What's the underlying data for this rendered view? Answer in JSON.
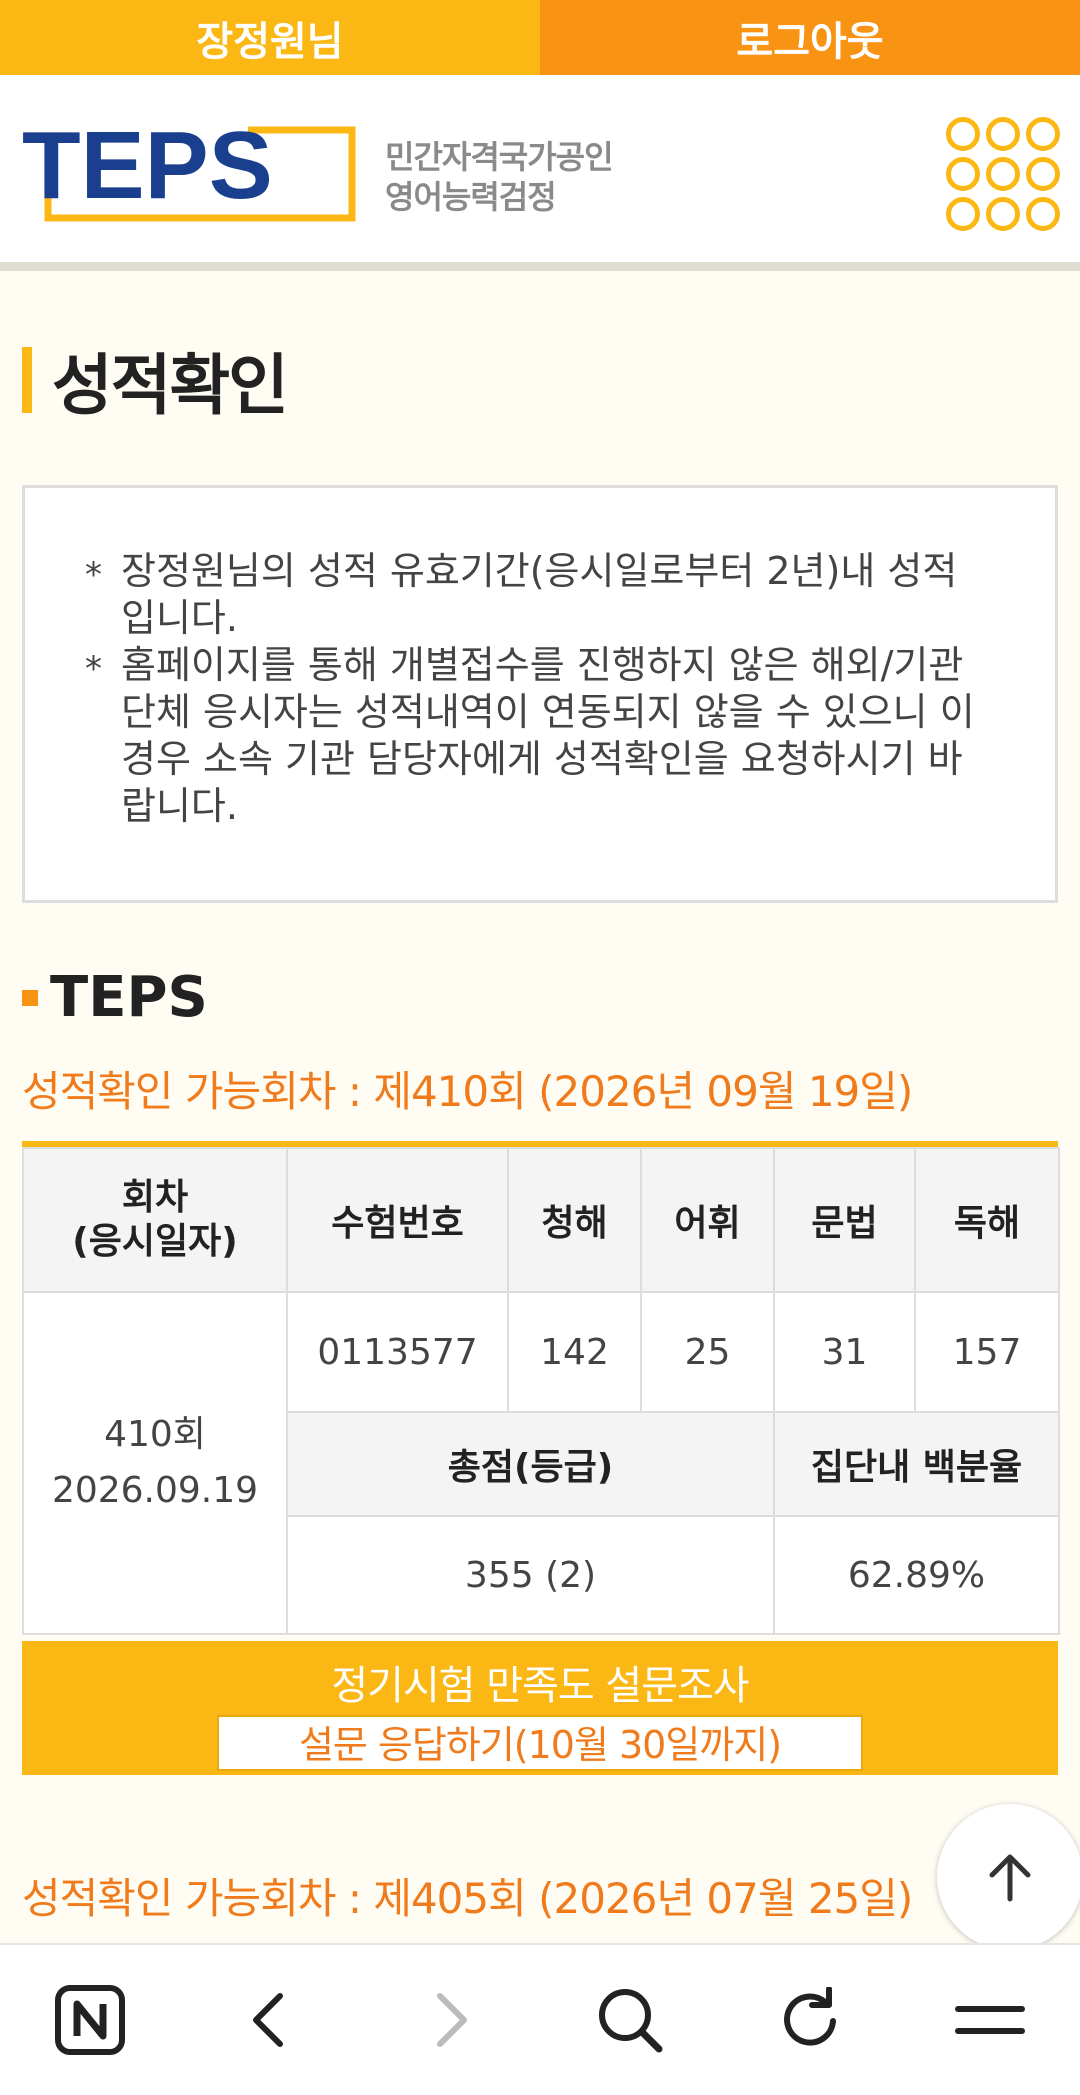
{
  "topbar": {
    "user_label": "장정원님",
    "logout_label": "로그아웃"
  },
  "header": {
    "logo_text": "TEPS",
    "subtitle_line1": "민간자격국가공인",
    "subtitle_line2": "영어능력검정",
    "menu_icon": "grid-menu-icon"
  },
  "page": {
    "title": "성적확인"
  },
  "notice": {
    "line1": "장정원님의 성적 유효기간(응시일로부터 2년)내 성적 입니다.",
    "line2": "홈페이지를 통해 개별접수를 진행하지 않은 해외/기관 단체 응시자는 성적내역이 연동되지 않을 수 있으니 이 경우 소속 기관 담당자에게 성적확인을 요청하시기 바랍니다."
  },
  "section": {
    "title": "TEPS"
  },
  "rounds": [
    {
      "available": "성적확인 가능회차 : 제410회 (2026년 09월 19일)"
    },
    {
      "available": "성적확인 가능회차 : 제405회 (2026년 07월 25일)"
    }
  ],
  "table": {
    "headers": {
      "round": "회차\n(응시일자)",
      "exam_no": "수험번호",
      "listening": "청해",
      "vocab": "어휘",
      "grammar": "문법",
      "reading": "독해"
    },
    "round_label": "410회",
    "round_date": "2026.09.19",
    "exam_no": "0113577",
    "listening": "142",
    "vocab": "25",
    "grammar": "31",
    "reading": "157",
    "total_header": "총점(등급)",
    "percentile_header": "집단내 백분율",
    "total": "355 (2)",
    "percentile": "62.89%"
  },
  "survey": {
    "title": "정기시험 만족도 설문조사",
    "button_label": "설문 응답하기(10월 30일까지)"
  },
  "colors": {
    "accent_yellow": "#fbb713",
    "accent_orange": "#f99314",
    "text_orange": "#f07b1c",
    "logo_blue": "#1b3f8f"
  },
  "bottom_nav": {
    "icons": [
      "naver-home-icon",
      "back-icon",
      "forward-icon",
      "search-icon",
      "refresh-icon",
      "menu-icon"
    ]
  }
}
